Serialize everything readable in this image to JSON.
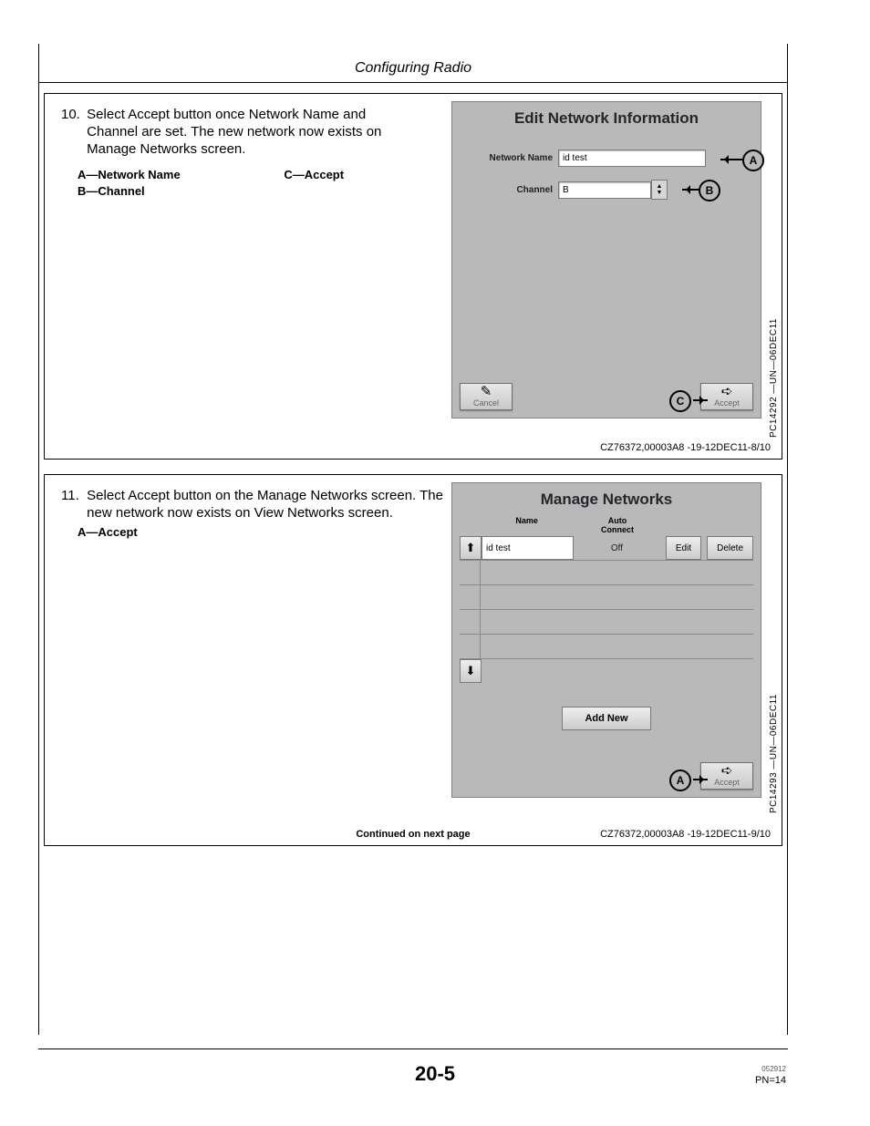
{
  "header": {
    "title": "Configuring Radio"
  },
  "step10": {
    "number": "10.",
    "text": "Select Accept button once Network Name and Channel are set.  The new network now exists on Manage Networks screen.",
    "legend": {
      "a": "A—Network Name",
      "b": "B—Channel",
      "c": "C—Accept"
    },
    "ui": {
      "title": "Edit Network Information",
      "networkName": {
        "label": "Network Name",
        "value": "id test"
      },
      "channel": {
        "label": "Channel",
        "value": "B"
      },
      "cancel": "Cancel",
      "accept": "Accept",
      "callouts": {
        "a": "A",
        "b": "B",
        "c": "C"
      }
    },
    "vcode": "PC14292 —UN—06DEC11",
    "footcode": "CZ76372,00003A8 -19-12DEC11-8/10"
  },
  "step11": {
    "number": "11.",
    "text": "Select Accept button on the Manage Networks screen. The new network now exists on View Networks screen.",
    "legend": {
      "a": "A—Accept"
    },
    "ui": {
      "title": "Manage Networks",
      "headers": {
        "name": "Name",
        "auto": "Auto\nConnect"
      },
      "row": {
        "name": "id test",
        "auto": "Off",
        "edit": "Edit",
        "delete": "Delete"
      },
      "addNew": "Add New",
      "accept": "Accept",
      "callouts": {
        "a": "A"
      }
    },
    "continued": "Continued on next page",
    "vcode": "PC14293 —UN—06DEC11",
    "footcode": "CZ76372,00003A8 -19-12DEC11-9/10"
  },
  "footer": {
    "pageNumber": "20-5",
    "pn": "PN=14",
    "tiny": "052912"
  }
}
